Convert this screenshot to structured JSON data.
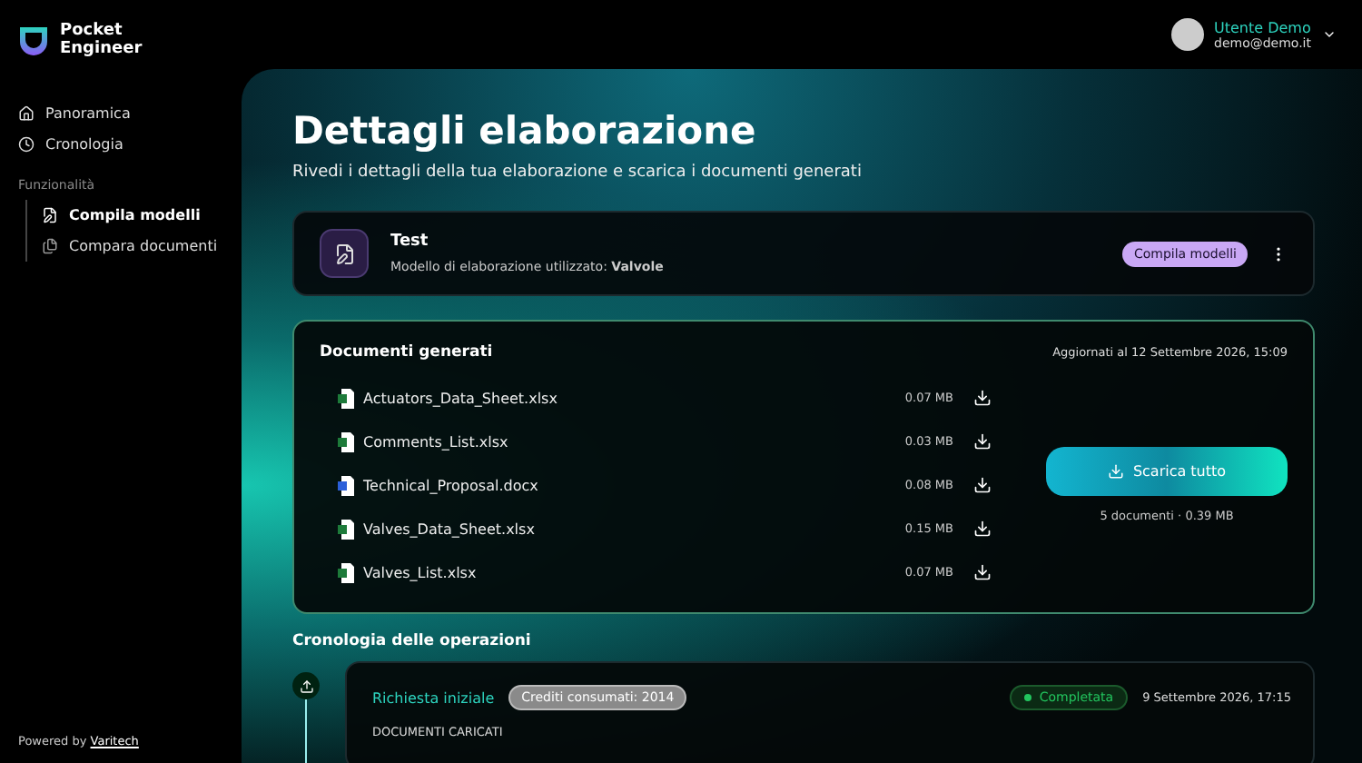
{
  "brand": {
    "line1": "Pocket",
    "line2": "Engineer"
  },
  "nav": [
    {
      "label": "Panoramica",
      "kind": "home",
      "selected": false
    },
    {
      "label": "Cronologia",
      "kind": "clock",
      "selected": false
    }
  ],
  "section_label": "Funzionalità",
  "features": [
    {
      "label": "Compila modelli",
      "kind": "fill",
      "selected": true
    },
    {
      "label": "Compara documenti",
      "kind": "compare",
      "selected": false
    }
  ],
  "footer": {
    "prefix": "Powered by",
    "link": "Varitech"
  },
  "user": {
    "name": "Utente Demo",
    "email": "demo@demo.it"
  },
  "page": {
    "title": "Dettagli elaborazione",
    "subtitle": "Rivedi i dettagli della tua elaborazione e scarica i documenti generati"
  },
  "job": {
    "name": "Test",
    "model_label": "Modello di elaborazione utilizzato:",
    "model": "Valvole",
    "badge": "Compila modelli"
  },
  "documents": {
    "title": "Documenti generati",
    "updated": "Aggiornati al 12 Settembre 2026, 15:09",
    "files": [
      {
        "name": "Actuators_Data_Sheet.xlsx",
        "size": "0.07 MB",
        "kind": "xlsx"
      },
      {
        "name": "Comments_List.xlsx",
        "size": "0.03 MB",
        "kind": "xlsx"
      },
      {
        "name": "Technical_Proposal.docx",
        "size": "0.08 MB",
        "kind": "docx"
      },
      {
        "name": "Valves_Data_Sheet.xlsx",
        "size": "0.15 MB",
        "kind": "xlsx"
      },
      {
        "name": "Valves_List.xlsx",
        "size": "0.07 MB",
        "kind": "xlsx"
      }
    ],
    "download_all": "Scarica tutto",
    "summary": "5 documenti · 0.39 MB"
  },
  "timeline": {
    "title": "Cronologia delle operazioni",
    "events": [
      {
        "title": "Richiesta iniziale",
        "credits": "Crediti consumati: 2014",
        "status": "Completata",
        "color": "#22c55e",
        "date": "9 Settembre 2026, 17:15",
        "section": "DOCUMENTI CARICATI"
      }
    ]
  }
}
